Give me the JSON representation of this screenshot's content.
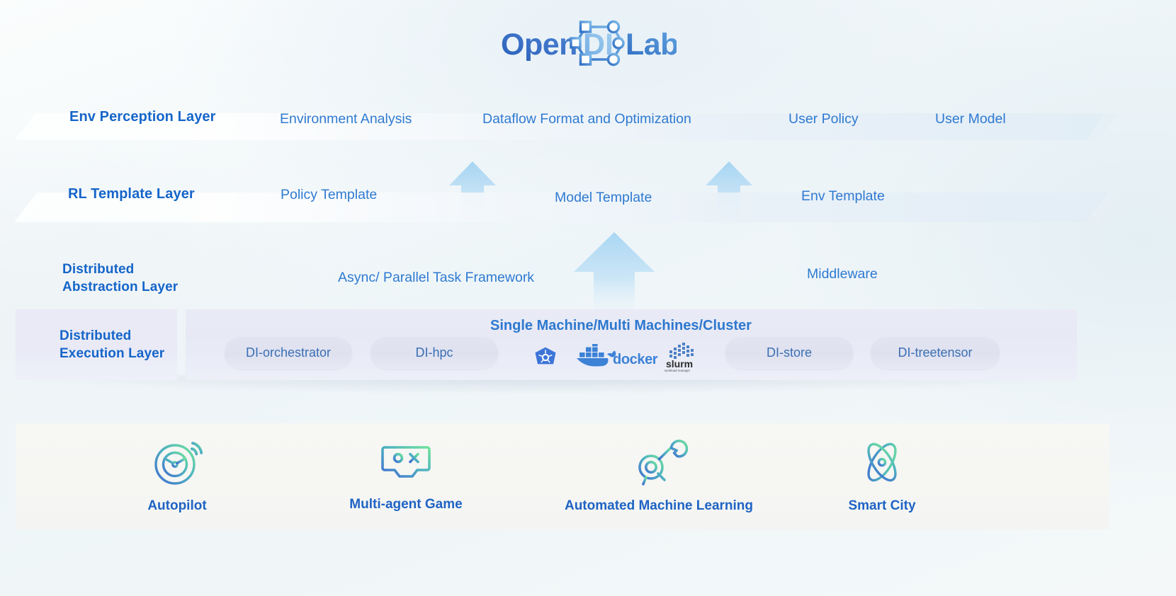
{
  "logo": {
    "text_open": "Open",
    "text_di": "DI",
    "text_lab": "Lab",
    "alt": "OpenDILab",
    "color_dark": "#2f6fc4",
    "color_light": "#7ab6e8"
  },
  "layers": [
    {
      "id": "env-perception",
      "side_label": "Env Perception Layer",
      "items": [
        {
          "label": "Environment Analysis"
        },
        {
          "label": "Dataflow Format and Optimization"
        },
        {
          "label": "User Policy"
        },
        {
          "label": "User Model"
        }
      ]
    },
    {
      "id": "rl-template",
      "side_label": "RL Template Layer",
      "items": [
        {
          "label": "Policy Template"
        },
        {
          "label": "Model Template"
        },
        {
          "label": "Env Template"
        }
      ]
    },
    {
      "id": "distributed-abstraction",
      "side_label": "Distributed\nAbstraction Layer",
      "items": [
        {
          "label": "Async/ Parallel Task Framework"
        },
        {
          "label": "Middleware"
        }
      ]
    },
    {
      "id": "distributed-execution",
      "side_label": "Distributed\nExecution Layer",
      "title": "Single Machine/Multi Machines/Cluster",
      "components": [
        {
          "label": "DI-orchestrator",
          "kind": "pill"
        },
        {
          "label": "DI-hpc",
          "kind": "pill"
        },
        {
          "label": "kubernetes",
          "kind": "logo",
          "icon": "kubernetes-icon"
        },
        {
          "label": "docker",
          "kind": "logo",
          "icon": "docker-icon"
        },
        {
          "label": "slurm",
          "kind": "logo",
          "icon": "slurm-icon",
          "sublabel": "workload manager"
        },
        {
          "label": "DI-store",
          "kind": "pill"
        },
        {
          "label": "DI-treetensor",
          "kind": "pill"
        }
      ]
    }
  ],
  "applications": [
    {
      "label": "Autopilot",
      "icon": "steering-wheel-icon"
    },
    {
      "label": "Multi-agent Game",
      "icon": "game-controller-icon"
    },
    {
      "label": "Automated Machine Learning",
      "icon": "wrench-gear-icon"
    },
    {
      "label": "Smart City",
      "icon": "atom-icon"
    }
  ],
  "colors": {
    "layer_label": "#1565c9",
    "item_text": "#2f7ad1",
    "exec_title": "#2d78cf",
    "pill_text": "#3b6fb4",
    "app_label": "#1f63c4",
    "arrow": "#a8d4ef",
    "gradient_start": "#3f6fd0",
    "gradient_end": "#6fe39b"
  }
}
